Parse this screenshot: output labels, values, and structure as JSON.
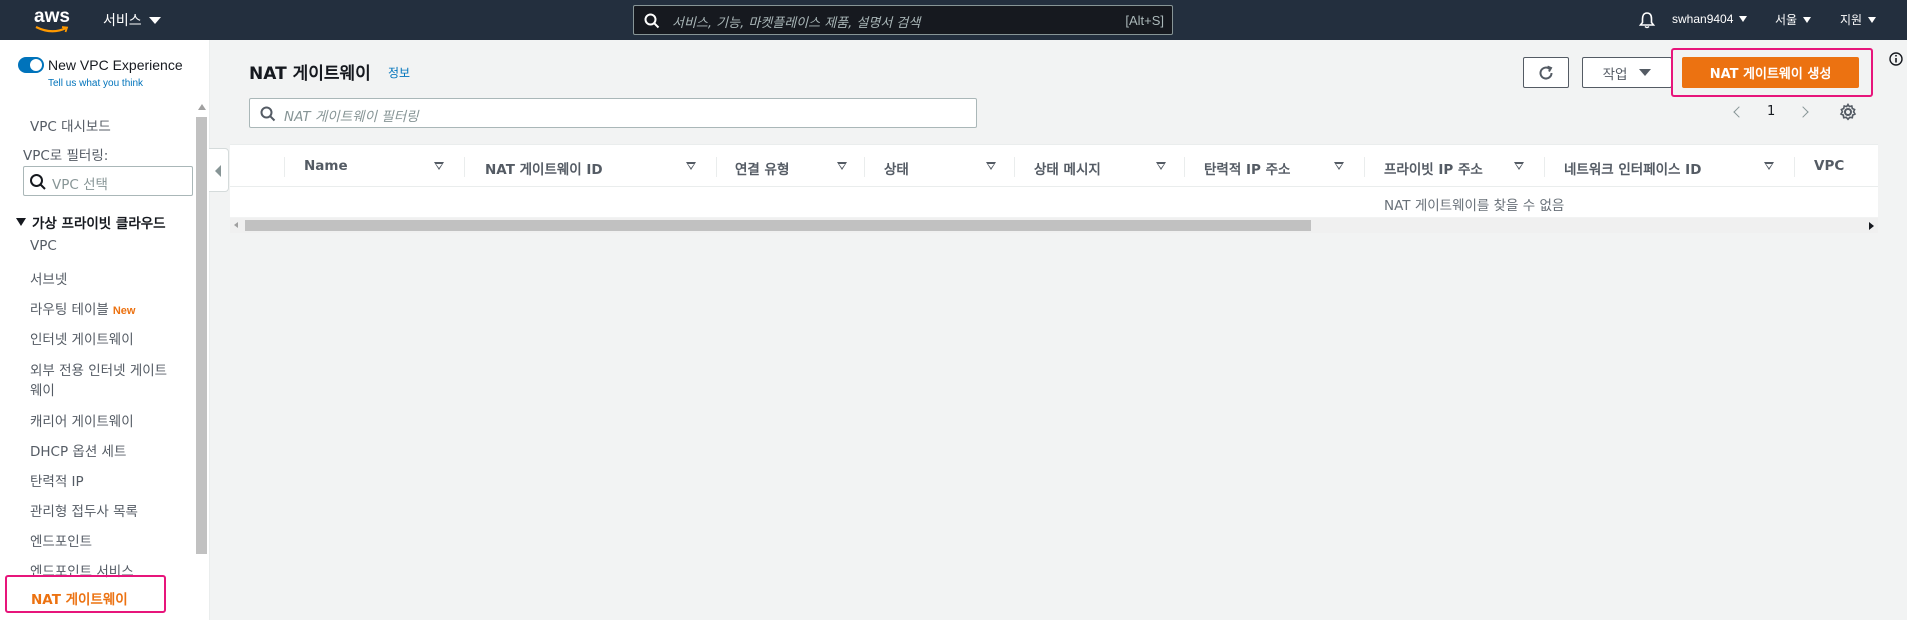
{
  "topnav": {
    "logo_text": "aws",
    "services_label": "서비스",
    "search_placeholder": "서비스, 기능, 마켓플레이스 제품, 설명서 검색",
    "search_shortcut": "[Alt+S]",
    "user": "swhan9404",
    "region": "서울",
    "support": "지원"
  },
  "sidebar": {
    "new_experience_label": "New VPC Experience",
    "tell_us": "Tell us what you think",
    "dashboard": "VPC 대시보드",
    "filter_label": "VPC로 필터링:",
    "vpc_select_placeholder": "VPC 선택",
    "group_label": "가상 프라이빗 클라우드",
    "items": [
      {
        "label": "VPC"
      },
      {
        "label": "서브넷"
      },
      {
        "label": "라우팅 테이블",
        "badge": "New"
      },
      {
        "label": "인터넷 게이트웨이"
      },
      {
        "label": "외부 전용 인터넷 게이트"
      },
      {
        "label": "웨이"
      },
      {
        "label": "캐리어 게이트웨이"
      },
      {
        "label": "DHCP 옵션 세트"
      },
      {
        "label": "탄력적 IP"
      },
      {
        "label": "관리형 접두사 목록"
      },
      {
        "label": "엔드포인트"
      },
      {
        "label": "엔드포인트 서비스"
      }
    ],
    "active_item": "NAT 게이트웨이"
  },
  "main": {
    "title": "NAT 게이트웨이",
    "info_link": "정보",
    "actions_label": "작업",
    "create_label": "NAT 게이트웨이 생성",
    "filter_placeholder": "NAT 게이트웨이 필터링",
    "page": "1"
  },
  "table": {
    "columns": [
      "Name",
      "NAT 게이트웨이 ID",
      "연결 유형",
      "상태",
      "상태 메시지",
      "탄력적 IP 주소",
      "프라이빗 IP 주소",
      "네트워크 인터페이스 ID",
      "VPC"
    ],
    "empty_message": "NAT 게이트웨이를 찾을 수 없음"
  },
  "colors": {
    "topnav_bg": "#232f3e",
    "primary_button": "#ec7211",
    "highlight": "#e7157b",
    "link": "#0073bb"
  }
}
